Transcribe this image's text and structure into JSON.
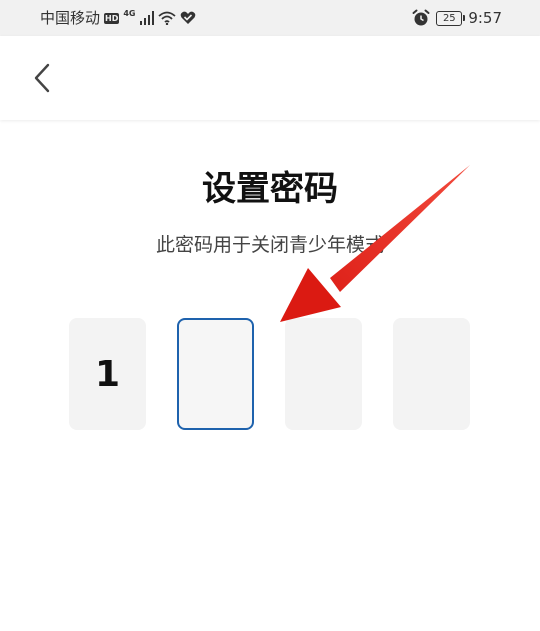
{
  "status_bar": {
    "carrier": "中国移动",
    "hd": "HD",
    "network": "4G",
    "battery": "25",
    "time": "9:57"
  },
  "header": {
    "back_icon": "chevron-left-icon"
  },
  "main": {
    "title": "设置密码",
    "subtitle": "此密码用于关闭青少年模式",
    "pin_digits": [
      "1",
      "",
      "",
      ""
    ],
    "active_index": 1
  },
  "colors": {
    "accent": "#1e62ad",
    "annotation_arrow": "#e3211c",
    "box_bg": "#f3f3f3"
  }
}
